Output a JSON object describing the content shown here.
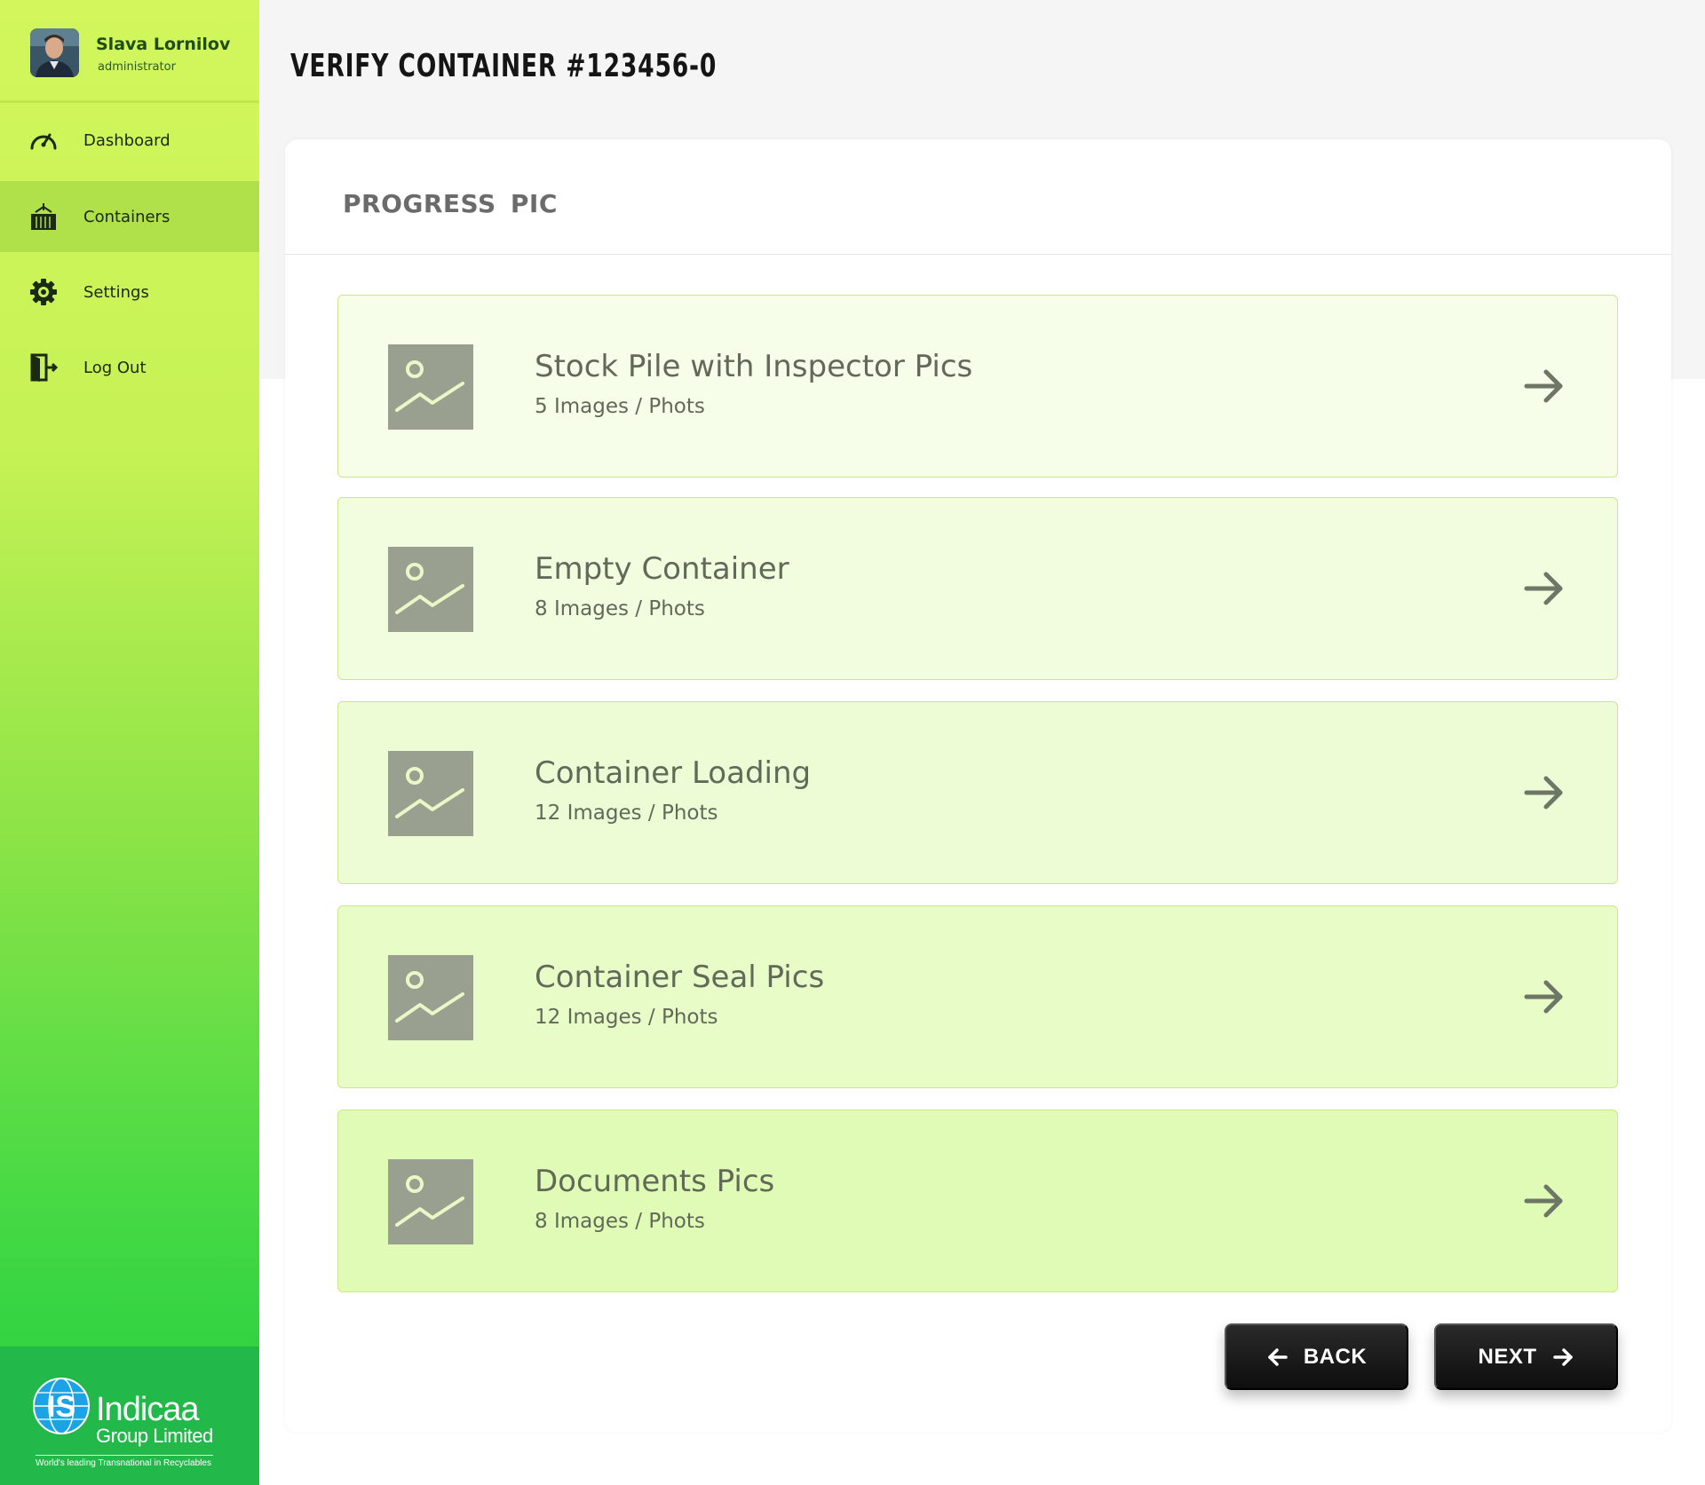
{
  "user": {
    "name": "Slava Lornilov",
    "role": "administrator"
  },
  "nav": [
    {
      "label": "Dashboard",
      "icon": "speedometer-icon",
      "active": false
    },
    {
      "label": "Containers",
      "icon": "container-icon",
      "active": true
    },
    {
      "label": "Settings",
      "icon": "gear-icon",
      "active": false
    },
    {
      "label": "Log Out",
      "icon": "logout-icon",
      "active": false
    }
  ],
  "brand": {
    "name": "Indicaa",
    "sub": "Group Limited",
    "tagline": "World's leading Transnational in Recyclables",
    "mark": "IS"
  },
  "page": {
    "title": "VERIFY CONTAINER #123456-0"
  },
  "section": {
    "title": "PROGRESS PIC"
  },
  "items": [
    {
      "title": "Stock Pile with Inspector Pics",
      "count": "5 Images / Phots",
      "bg": "#f6fde8"
    },
    {
      "title": "Empty Container",
      "count": "8 Images / Phots",
      "bg": "#f2fde0"
    },
    {
      "title": "Container Loading",
      "count": "12 Images / Phots",
      "bg": "#eefcd6"
    },
    {
      "title": "Container Seal Pics",
      "count": "12 Images / Phots",
      "bg": "#e8fcc8"
    },
    {
      "title": "Documents Pics",
      "count": "8 Images / Phots",
      "bg": "#e0fbb5"
    }
  ],
  "buttons": {
    "back": "BACK",
    "next": "NEXT"
  },
  "colors": {
    "accent": "#c6f255",
    "sidebar_bottom": "#20cc40",
    "thumb": "#9aa08f",
    "button": "#111111"
  }
}
